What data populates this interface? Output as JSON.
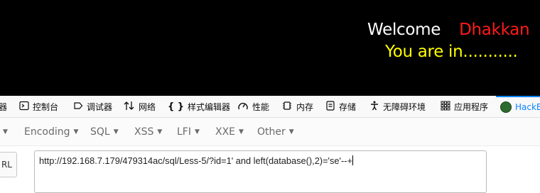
{
  "page": {
    "welcome": "Welcome",
    "username": "Dhakkan",
    "status": "You are in..........."
  },
  "devtools": {
    "tabs": [
      {
        "label": "器",
        "icon": "inspector-icon"
      },
      {
        "label": "控制台",
        "icon": "console-icon"
      },
      {
        "label": "调试器",
        "icon": "debugger-icon"
      },
      {
        "label": "网络",
        "icon": "network-icon"
      },
      {
        "label": "样式编辑器",
        "icon": "style-editor-icon"
      },
      {
        "label": "性能",
        "icon": "performance-icon"
      },
      {
        "label": "内存",
        "icon": "memory-icon"
      },
      {
        "label": "存储",
        "icon": "storage-icon"
      },
      {
        "label": "无障碍环境",
        "icon": "accessibility-icon"
      },
      {
        "label": "应用程序",
        "icon": "application-icon"
      },
      {
        "label": "HackB",
        "icon": "hackbar-icon"
      }
    ]
  },
  "hackbar": {
    "menu": [
      "Encoding",
      "SQL",
      "XSS",
      "LFI",
      "XXE",
      "Other"
    ],
    "side_button": "RL",
    "url_value": "http://192.168.7.179/479314ac/sql/Less-5/?id=1' and left(database(),2)='se'--+"
  },
  "colors": {
    "page_background": "#000000",
    "welcome": "#ffffff",
    "username": "#ff1a1a",
    "status": "#ffff00",
    "active_tab": "#0a84ff"
  }
}
